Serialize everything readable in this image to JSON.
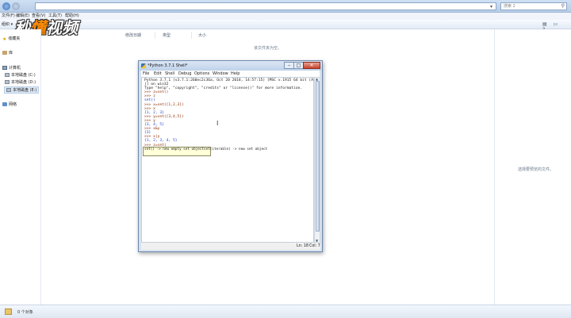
{
  "explorer": {
    "menu": [
      "文件(F)",
      "编辑(E)",
      "查看(V)",
      "工具(T)",
      "帮助(H)"
    ],
    "organize_label": "组织 ▾",
    "address_text": "",
    "search_placeholder": "搜索 2",
    "logo_text": "秒懂视频",
    "nav": {
      "favorites": "收藏夹",
      "libraries": "库",
      "computer": "计算机",
      "drive_c": "本地磁盘 (C:)",
      "drive_d": "本地磁盘 (D:)",
      "drive_e": "本地磁盘 (E:)",
      "network": "网络"
    },
    "columns": {
      "date": "修改日期",
      "type": "类型",
      "size": "大小"
    },
    "empty_message": "该文件夹为空。",
    "preview_message": "选择要预览的文件。",
    "status_text": "0 个对象"
  },
  "shell": {
    "title": "*Python 3.7.1 Shell*",
    "menu": [
      "File",
      "Edit",
      "Shell",
      "Debug",
      "Options",
      "Window",
      "Help"
    ],
    "lines": [
      {
        "cls": "c-out",
        "text": "Python 3.7.1 (v3.7.1:260ec2c36a, Oct 20 2018, 14:57:15) [MSC v.1915 64 bit (AMD64"
      },
      {
        "cls": "c-out",
        "text": ")] on win32"
      },
      {
        "cls": "c-out",
        "text": "Type \"help\", \"copyright\", \"credits\" or \"license()\" for more information."
      },
      {
        "cls": "c-prompt",
        "text": ">>> z=set()"
      },
      {
        "cls": "c-prompt",
        "text": ">>> z"
      },
      {
        "cls": "c-res",
        "text": "set()"
      },
      {
        "cls": "c-prompt",
        "text": ">>> x=set([1,2,3])"
      },
      {
        "cls": "c-prompt",
        "text": ">>> x"
      },
      {
        "cls": "c-res",
        "text": "{1, 2, 3}"
      },
      {
        "cls": "c-prompt",
        "text": ">>> y=set([3,4,5])"
      },
      {
        "cls": "c-prompt",
        "text": ">>> y"
      },
      {
        "cls": "c-res",
        "text": "{3, 4, 5}"
      },
      {
        "cls": "c-prompt",
        "text": ">>> x&y"
      },
      {
        "cls": "c-res",
        "text": "{3}"
      },
      {
        "cls": "c-prompt",
        "text": ">>> x|y"
      },
      {
        "cls": "c-res",
        "text": "{1, 2, 3, 4, 5}"
      },
      {
        "cls": "c-prompt",
        "text": ">>> z=set("
      }
    ],
    "calltip_lines": [
      "set() -> new empty set object",
      "set(iterable) -> new set object"
    ],
    "status_ln": "Ln: 18",
    "status_col": "Col: 7"
  }
}
